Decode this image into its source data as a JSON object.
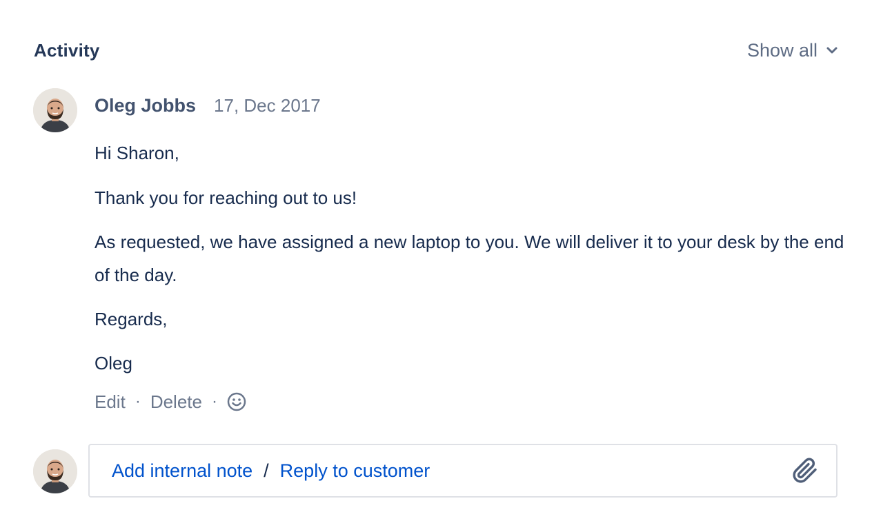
{
  "activity": {
    "title": "Activity",
    "show_all_label": "Show all",
    "show_all_icon": "chevron-down-icon"
  },
  "comment": {
    "author": "Oleg Jobbs",
    "date": "17, Dec 2017",
    "paragraphs": [
      "Hi Sharon,",
      "Thank you for reaching out to us!",
      "As requested, we have assigned a new laptop to you. We will deliver it to your desk by the end of the day.",
      "Regards,",
      "Oleg"
    ],
    "actions": {
      "edit_label": "Edit",
      "delete_label": "Delete",
      "separator": "·",
      "emoji_icon": "smiley-icon"
    }
  },
  "reply": {
    "internal_note_label": "Add internal note",
    "separator": "/",
    "reply_label": "Reply to customer",
    "attach_icon": "paperclip-icon"
  },
  "colors": {
    "link": "#0052cc",
    "text": "#172b4d",
    "subtle": "#6b778c",
    "border": "#dfe1e6"
  }
}
